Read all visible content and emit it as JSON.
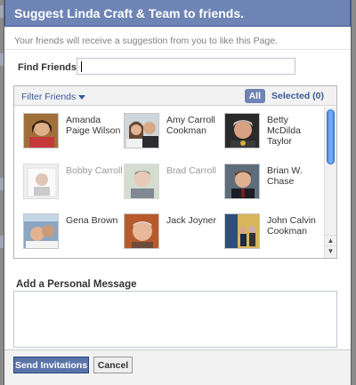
{
  "dialog": {
    "title": "Suggest Linda Craft & Team to friends.",
    "subtitle": "Your friends will receive a suggestion from you to like this Page."
  },
  "find": {
    "label": "Find Friends:",
    "value": ""
  },
  "filter": {
    "label": "Filter Friends",
    "tab_all": "All",
    "tab_selected": "Selected (0)"
  },
  "friends": [
    {
      "name": "Amanda Paige Wilson",
      "dim": false
    },
    {
      "name": "Amy Carroll Cookman",
      "dim": false
    },
    {
      "name": "Betty McDilda Taylor",
      "dim": false
    },
    {
      "name": "Bobby Carroll",
      "dim": true
    },
    {
      "name": "Brad Carroll",
      "dim": true
    },
    {
      "name": "Brian W. Chase",
      "dim": false
    },
    {
      "name": "Gena Brown",
      "dim": false
    },
    {
      "name": "Jack Joyner",
      "dim": false
    },
    {
      "name": "John Calvin Cookman",
      "dim": false
    }
  ],
  "message": {
    "heading": "Add a Personal Message",
    "value": ""
  },
  "buttons": {
    "send": "Send Invitations",
    "cancel": "Cancel"
  },
  "colors": {
    "title_bar": "#6d84b4",
    "link": "#3b5998",
    "send_button": "#5b74a8"
  }
}
